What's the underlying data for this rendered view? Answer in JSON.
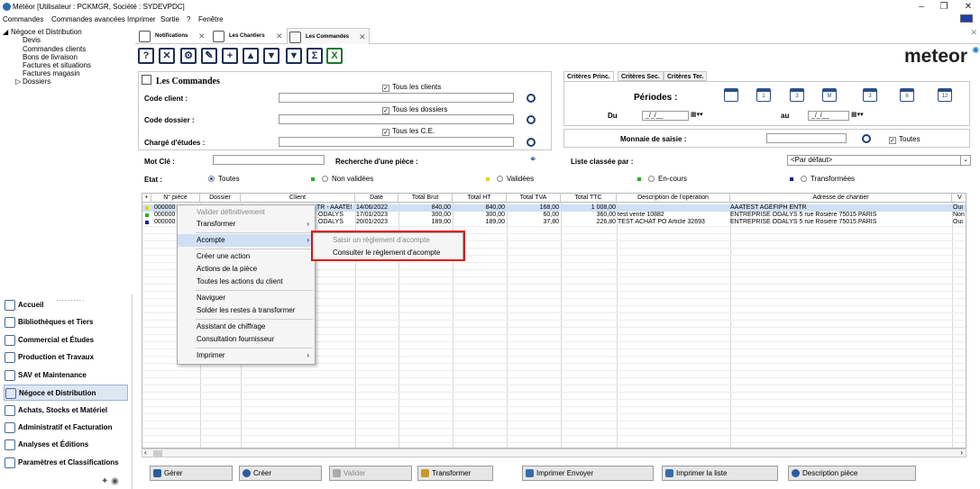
{
  "window": {
    "title": "Météor [Utilisateur : PCKMGR, Société : SYDEVPDC]"
  },
  "menubar": [
    "Commandes",
    "Commandes avancées",
    "Imprimer",
    "Sortie",
    "?",
    "Fenêtre"
  ],
  "tree": {
    "root": "Négoce et Distribution",
    "children": [
      "Devis",
      "Commandes clients",
      "Bons de livraison",
      "Factures et situations",
      "Factures magasin",
      "Dossiers"
    ]
  },
  "nav": {
    "items": [
      {
        "label": "Accueil",
        "icon": "home-icon"
      },
      {
        "label": "Bibliothèques et Tiers",
        "icon": "library-icon"
      },
      {
        "label": "Commercial et Études",
        "icon": "commercial-icon"
      },
      {
        "label": "Production et Travaux",
        "icon": "production-icon"
      },
      {
        "label": "SAV et Maintenance",
        "icon": "maintenance-icon"
      },
      {
        "label": "Négoce et Distribution",
        "icon": "negoce-icon"
      },
      {
        "label": "Achats, Stocks et Matériel",
        "icon": "cart-icon"
      },
      {
        "label": "Administratif et Facturation",
        "icon": "admin-icon"
      },
      {
        "label": "Analyses et Éditions",
        "icon": "analysis-icon"
      },
      {
        "label": "Paramètres et Classifications",
        "icon": "settings-icon"
      }
    ],
    "selected": "Négoce et Distribution"
  },
  "tabs": [
    {
      "label": "Notifications"
    },
    {
      "label": "Les Chantiers"
    },
    {
      "label": "Les Commandes"
    }
  ],
  "toolbar": {
    "icons": [
      "help-icon",
      "close-icon",
      "settings-icon",
      "edit-icon",
      "add-icon",
      "move-up-icon",
      "move-down-icon",
      "filter-icon",
      "sum-icon",
      "excel-icon"
    ],
    "glyphs": [
      "?",
      "✕",
      "⚙",
      "✎",
      "+",
      "▲",
      "▼",
      "▼",
      "Σ",
      "X"
    ]
  },
  "logo": "meteor",
  "search": {
    "title": "Les Commandes",
    "code_client_label": "Code client :",
    "tous_clients": "Tous les clients",
    "code_dossier_label": "Code dossier :",
    "tous_dossiers": "Tous les dossiers",
    "charge_label": "Chargé d'études :",
    "tous_ce": "Tous les C.E.",
    "mot_cle_label": "Mot Clé :",
    "recherche_label": "Recherche d'une pièce :",
    "etat_label": "Etat :",
    "etats": [
      "Toutes",
      "Non validées",
      "Validées",
      "En-cours",
      "Transformées"
    ],
    "etat_colors": [
      "#000000",
      "#1db51d",
      "#e6d200",
      "#1db51d",
      "#1a1a8c"
    ],
    "liste_label": "Liste classée par :",
    "liste_value": "<Par défaut>"
  },
  "criteria": {
    "tabs": [
      "Critères Princ.",
      "Critères Sec.",
      "Critères Ter."
    ],
    "periodes_label": "Périodes :",
    "period_icons": [
      "·",
      "1",
      "3",
      "M",
      "3",
      "6",
      "12"
    ],
    "du_label": "Du",
    "au_label": "au",
    "date_placeholder": "_/_/__",
    "monnaie_label": "Monnaie de saisie :",
    "toutes_label": "Toutes"
  },
  "table": {
    "columns": [
      "+",
      "N° pièce",
      "Dossier",
      "Client",
      "Date",
      "Total Brut",
      "Total HT",
      "Total TVA",
      "Total TTC",
      "Description de l'opération",
      "Adresse de chantier",
      "V"
    ],
    "rows": [
      {
        "status_color": "#e6d200",
        "piece": "000000",
        "client": "TR - AAATE!",
        "date": "14/06/2022",
        "brut": "840,00",
        "ht": "840,00",
        "tva": "168,00",
        "ttc": "1 008,00",
        "desc": "",
        "adresse": "AAATEST AGEFIPH ENTR",
        "v": "Oui"
      },
      {
        "status_color": "#1db51d",
        "piece": "000000",
        "client": "ODALYS",
        "date": "17/01/2023",
        "brut": "300,00",
        "ht": "300,00",
        "tva": "60,00",
        "ttc": "360,00",
        "desc": "test vente 10882",
        "adresse": "ENTREPRISE ODALYS 5 rue Rosière  75015 PARIS",
        "v": "Non"
      },
      {
        "status_color": "#1a1a8c",
        "piece": "000000",
        "client": "ODALYS",
        "date": "20/01/2023",
        "brut": "189,00",
        "ht": "189,00",
        "tva": "37,80",
        "ttc": "226,80",
        "desc": "TEST ACHAT PO Article 32693",
        "adresse": "ENTREPRISE ODALYS 5 rue Rosière  75015 PARIS",
        "v": "Oui"
      }
    ]
  },
  "context_menu": [
    {
      "label": "Valider définitivement",
      "disabled": true
    },
    {
      "label": "Transformer",
      "submenu": true
    },
    {
      "label": "Acompte",
      "submenu": true,
      "highlight": true
    },
    {
      "label": "Créer une action"
    },
    {
      "label": "Actions de la pièce"
    },
    {
      "label": "Toutes les actions du client"
    },
    {
      "label": "Naviguer"
    },
    {
      "label": "Solder les restes à transformer"
    },
    {
      "label": "Assistant de chiffrage"
    },
    {
      "label": "Consultation fournisseur"
    },
    {
      "label": "Imprimer",
      "submenu": true
    }
  ],
  "submenu": [
    {
      "label": "Saisir un règlement d'acompte",
      "disabled": true
    },
    {
      "label": "Consulter le règlement d'acompte"
    }
  ],
  "bottom_buttons": [
    {
      "label": "Gérer",
      "icon": "gear-icon"
    },
    {
      "label": "Créer",
      "icon": "add-icon"
    },
    {
      "label": "Valider",
      "icon": "lock-icon",
      "disabled": true
    },
    {
      "label": "Transformer",
      "icon": "wand-icon"
    },
    {
      "label": "Imprimer Envoyer",
      "icon": "printer-icon"
    },
    {
      "label": "Imprimer la liste",
      "icon": "printer-icon"
    },
    {
      "label": "Description pièce",
      "icon": "info-icon"
    }
  ]
}
